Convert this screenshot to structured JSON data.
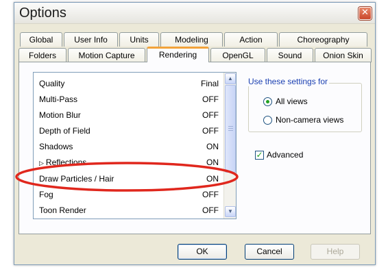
{
  "window": {
    "title": "Options",
    "close_glyph": "✕"
  },
  "tabs_back": [
    "Global",
    "User Info",
    "Units",
    "Modeling",
    "Action",
    "Choreography"
  ],
  "tabs_front": [
    "Folders",
    "Motion Capture",
    "Rendering",
    "OpenGL",
    "Sound",
    "Onion Skin"
  ],
  "active_tab": "Rendering",
  "settings_list": {
    "rows": [
      {
        "label": "Quality",
        "value": "Final"
      },
      {
        "label": "Multi-Pass",
        "value": "OFF"
      },
      {
        "label": "Motion Blur",
        "value": "OFF"
      },
      {
        "label": "Depth of Field",
        "value": "OFF"
      },
      {
        "label": "Shadows",
        "value": "ON"
      },
      {
        "label": "Reflections",
        "value": "ON",
        "expandable": true
      },
      {
        "label": "Draw Particles / Hair",
        "value": "ON",
        "highlighted": true
      },
      {
        "label": "Fog",
        "value": "OFF"
      },
      {
        "label": "Toon Render",
        "value": "OFF"
      }
    ],
    "expand_glyph": "▷"
  },
  "use_settings_for": {
    "title": "Use these settings for",
    "options": [
      "All views",
      "Non-camera views"
    ],
    "selected": "All views"
  },
  "advanced": {
    "label": "Advanced",
    "checked": true
  },
  "buttons": {
    "ok": "OK",
    "cancel": "Cancel",
    "help": "Help"
  },
  "colors": {
    "highlight_ring": "#e0271d",
    "active_tab_accent": "#f2a33a",
    "group_title": "#1a3fb1"
  },
  "icons": {
    "close": "close-icon",
    "scroll_up": "scroll-up-arrow-icon",
    "scroll_down": "scroll-down-arrow-icon",
    "expand": "expand-triangle-icon"
  }
}
